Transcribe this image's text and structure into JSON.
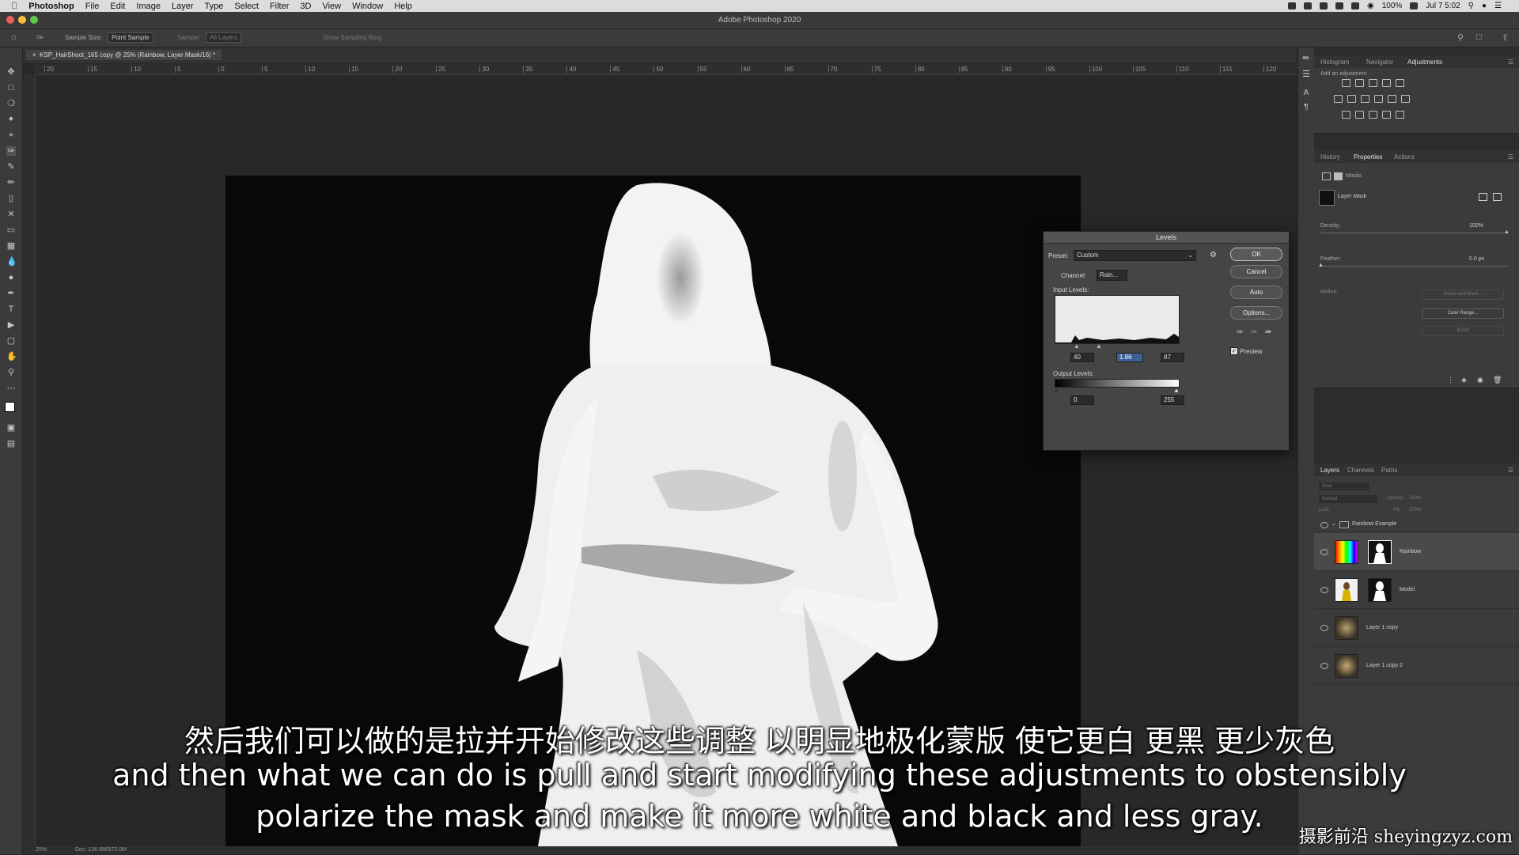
{
  "menubar": {
    "app": "Photoshop",
    "items": [
      "File",
      "Edit",
      "Image",
      "Layer",
      "Type",
      "Select",
      "Filter",
      "3D",
      "View",
      "Window",
      "Help"
    ],
    "battery": "100%",
    "clock": "Jul 7  5:02"
  },
  "window": {
    "title": "Adobe Photoshop 2020"
  },
  "options": {
    "sample_size_label": "Sample Size:",
    "sample_size_value": "Point Sample",
    "sample_label": "Sample:",
    "sample_value": "All Layers",
    "show_ring": "Show Sampling Ring"
  },
  "document": {
    "tab": "KSP_HairShoot_165 copy @ 25% (Rainbow, Layer Mask/16) *",
    "ruler_ticks": [
      "20",
      "15",
      "10",
      "5",
      "0",
      "5",
      "10",
      "15",
      "20",
      "25",
      "30",
      "35",
      "40",
      "45",
      "50",
      "55",
      "60",
      "65",
      "70",
      "75",
      "80",
      "85",
      "90",
      "95",
      "100",
      "105",
      "110",
      "115",
      "120"
    ]
  },
  "levels": {
    "title": "Levels",
    "preset_label": "Preset:",
    "preset_value": "Custom",
    "channel_label": "Channel:",
    "channel_value": "Rain...",
    "input_label": "Input Levels:",
    "input_black": "40",
    "input_gamma": "1.86",
    "input_white": "87",
    "output_label": "Output Levels:",
    "output_black": "0",
    "output_white": "255",
    "ok": "OK",
    "cancel": "Cancel",
    "auto": "Auto",
    "options": "Options...",
    "preview": "Preview"
  },
  "adjustments_panel": {
    "tabs": [
      "Histogram",
      "Navigator",
      "Adjustments"
    ],
    "add_label": "Add an adjustment"
  },
  "properties_panel": {
    "tabs": [
      "History",
      "Properties",
      "Actions"
    ],
    "masks_label": "Masks",
    "layer_mask_label": "Layer Mask",
    "density_label": "Density:",
    "density_value": "100%",
    "feather_label": "Feather:",
    "feather_value": "0.0 px",
    "refine_label": "Refine:",
    "select_mask": "Select and Mask...",
    "color_range": "Color Range...",
    "invert": "Invert"
  },
  "layers_panel": {
    "tabs": [
      "Layers",
      "Channels",
      "Paths"
    ],
    "kind": "Kind",
    "blend": "Normal",
    "opacity_label": "Opacity:",
    "opacity_value": "100%",
    "lock_label": "Lock:",
    "fill_label": "Fill:",
    "fill_value": "100%",
    "group": "Rainbow Example",
    "layers": [
      "Rainbow",
      "Model",
      "Layer 1 copy",
      "Layer 1 copy 2"
    ]
  },
  "status": {
    "zoom": "25%",
    "doc": "Doc: 126.6M/572.0M"
  },
  "subtitles": {
    "zh": "然后我们可以做的是拉并开始修改这些调整 以明显地极化蒙版 使它更白 更黑 更少灰色",
    "en_line1": "and then what we can do is pull and start modifying these adjustments to obstensibly",
    "en_line2": "polarize the mask and make it more white and black and less gray."
  },
  "watermark": "摄影前沿 sheyingzyz.com"
}
